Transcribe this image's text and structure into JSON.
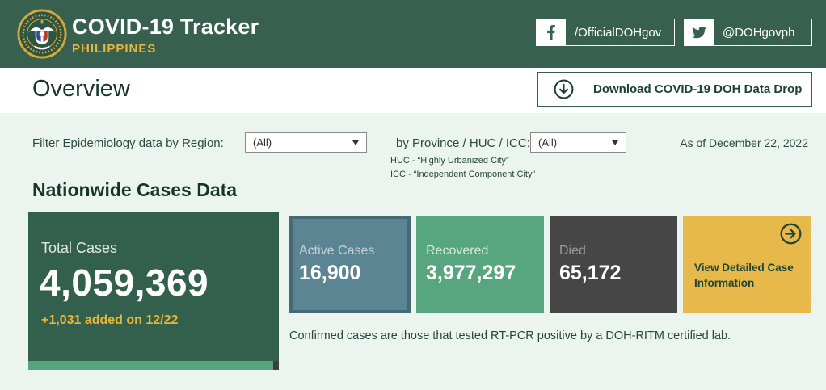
{
  "header": {
    "title": "COVID-19 Tracker",
    "subtitle": "PHILIPPINES",
    "facebook_handle": "/OfficialDOHgov",
    "twitter_handle": "@DOHgovph"
  },
  "overview": {
    "title": "Overview",
    "download_label": "Download COVID-19 DOH Data Drop"
  },
  "filters": {
    "region_label": "Filter Epidemiology data by Region:",
    "region_value": "(All)",
    "province_label": "by Province / HUC / ICC:",
    "province_value": "(All)",
    "huc_note": "HUC - “Highly Urbanized City”",
    "icc_note": "ICC - “Independent Component City”",
    "as_of": "As of December 22, 2022"
  },
  "section": {
    "heading": "Nationwide Cases Data",
    "confirmed_note": "Confirmed cases are those that tested RT-PCR positive by a DOH-RITM certified lab."
  },
  "cards": {
    "total": {
      "label": "Total Cases",
      "value": "4,059,369",
      "delta": "+1,031 added on 12/22"
    },
    "active": {
      "label": "Active Cases",
      "value": "16,900"
    },
    "recovered": {
      "label": "Recovered",
      "value": "3,977,297"
    },
    "died": {
      "label": "Died",
      "value": "65,172"
    },
    "detail": {
      "label": "View Detailed Case Information"
    }
  },
  "icons": {
    "logo": "doh-philippines-seal",
    "facebook": "facebook-f",
    "twitter": "twitter-bird",
    "download": "arrow-down-circle",
    "detail": "arrow-right-circle",
    "dropdown": "caret-down-triangle"
  },
  "colors": {
    "header_bg": "#38604F",
    "accent_yellow": "#E9B63C",
    "dark_text": "#15352B",
    "content_bg": "#ECF4F0",
    "total_card": "#33604D",
    "active_card": "#5C8593",
    "recovered_card": "#57A67F",
    "died_card": "#464646",
    "detail_card": "#E7B94A",
    "scroll_strip": "#56A37F"
  }
}
